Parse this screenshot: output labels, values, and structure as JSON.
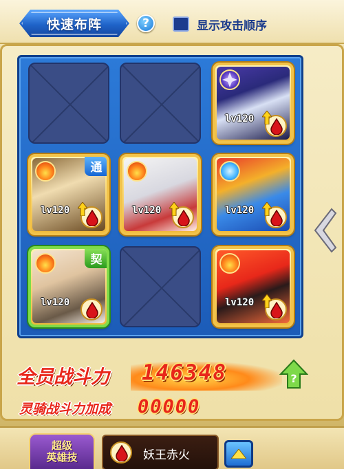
{
  "header": {
    "title": "快速布阵",
    "help_symbol": "?",
    "toggle_label": "显示攻击顺序",
    "toggle_checked": true
  },
  "formation": {
    "slots": [
      {
        "row": 1,
        "col": 1,
        "empty": true
      },
      {
        "row": 1,
        "col": 2,
        "empty": true
      },
      {
        "row": 1,
        "col": 3,
        "empty": false,
        "level": "lv120",
        "element": "dark-shuriken-icon",
        "frame": "gold",
        "tag": ""
      },
      {
        "row": 2,
        "col": 1,
        "empty": false,
        "level": "lv120",
        "element": "fire-icon",
        "frame": "gold",
        "tag": "通"
      },
      {
        "row": 2,
        "col": 2,
        "empty": false,
        "level": "lv120",
        "element": "fire-icon",
        "frame": "gold",
        "tag": ""
      },
      {
        "row": 2,
        "col": 3,
        "empty": false,
        "level": "lv120",
        "element": "water-icon",
        "frame": "gold",
        "tag": ""
      },
      {
        "row": 3,
        "col": 1,
        "empty": false,
        "level": "lv120",
        "element": "fire-icon",
        "frame": "green",
        "tag": "契"
      },
      {
        "row": 3,
        "col": 2,
        "empty": true
      },
      {
        "row": 3,
        "col": 3,
        "empty": false,
        "level": "lv120",
        "element": "fire-icon",
        "frame": "gold",
        "tag": ""
      }
    ]
  },
  "power": {
    "label": "全员战斗力",
    "value": "146348",
    "mount_label": "灵骑战斗力加成",
    "mount_value": "00000"
  },
  "skill": {
    "badge_line1": "超级",
    "badge_line2": "英雄技",
    "name": "妖王赤火"
  },
  "colors": {
    "board_blue": "#1c5cb8",
    "power_red": "#e8261a",
    "gold_frame": "#f2c34a",
    "green_frame": "#7fdc4a"
  }
}
